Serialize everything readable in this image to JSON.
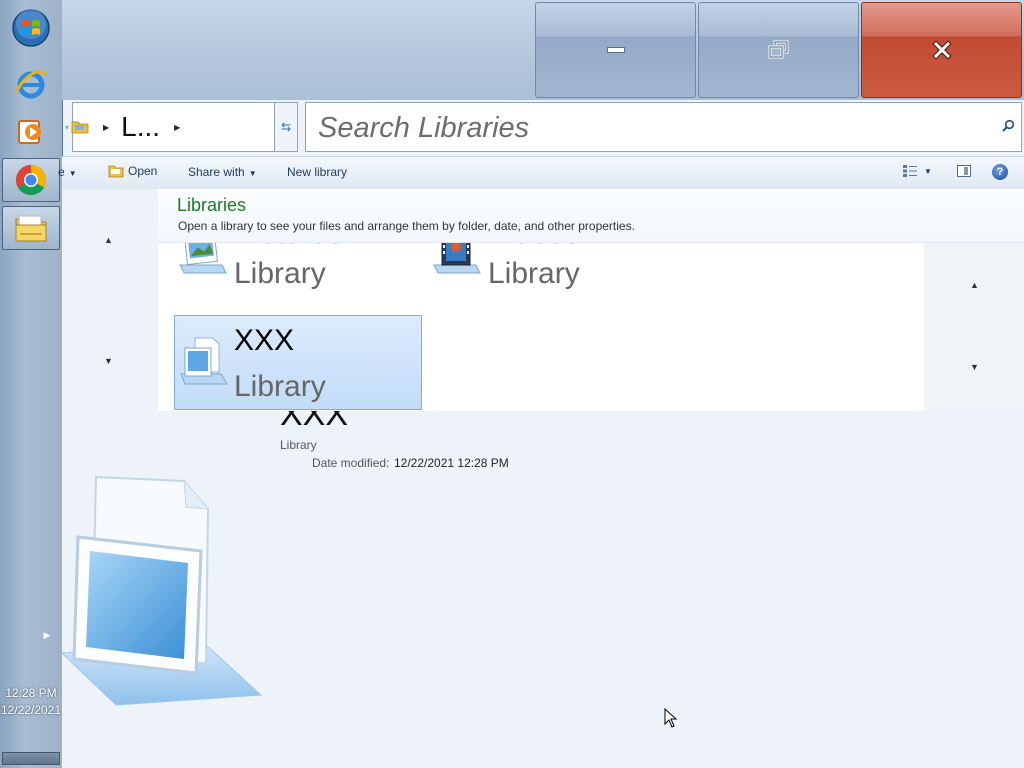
{
  "taskbar": {
    "items": [
      {
        "name": "start-orb"
      },
      {
        "name": "internet-explorer"
      },
      {
        "name": "windows-media-player"
      },
      {
        "name": "google-chrome"
      },
      {
        "name": "windows-explorer"
      }
    ],
    "clock_time": "12:28 PM",
    "clock_date": "12/22/2021"
  },
  "window": {
    "caption_buttons": {
      "minimize_icon": "minimize-icon",
      "restore_icon": "restore-icon",
      "close_icon": "close-icon"
    },
    "address": {
      "text": "L...",
      "folder_icon": "libraries-folder-icon"
    },
    "search": {
      "placeholder": "Search Libraries"
    },
    "command_bar": {
      "organize_label": "e",
      "open_label": "Open",
      "share_label": "Share with",
      "new_library_label": "New library"
    },
    "header": {
      "title": "Libraries",
      "description": "Open a library to see your files and arrange them by folder, date, and other properties."
    },
    "tiles": [
      {
        "name": "Pictures",
        "type": "Library",
        "icon": "pictures-library-icon"
      },
      {
        "name": "Videos",
        "type": "Library",
        "icon": "videos-library-icon"
      },
      {
        "name": "XXX",
        "type": "Library",
        "icon": "documents-library-icon",
        "selected": true
      }
    ],
    "details": {
      "name": "XXX",
      "type": "Library",
      "date_label": "Date modified:",
      "date_value": "12/22/2021 12:28 PM"
    }
  },
  "colors": {
    "close_red": "#c24a33",
    "header_green": "#1e7b20",
    "tile_name_red": "#e00000",
    "selection_blue": "#c2dcf8"
  }
}
